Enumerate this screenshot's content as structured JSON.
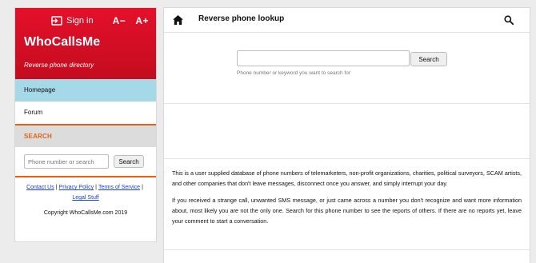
{
  "sidebar": {
    "signin_label": "Sign in",
    "font_decrease": "A−",
    "font_increase": "A+",
    "site_name": "WhoCallsMe",
    "tagline": "Reverse phone directory",
    "nav": {
      "home": "Homepage",
      "forum": "Forum"
    },
    "search_heading": "Search",
    "search_placeholder": "Phone number or search",
    "search_button": "Search",
    "footer": {
      "contact": "Contact Us",
      "privacy": "Privacy Policy",
      "terms": "Terms of Service",
      "legal": "Legal Stuff",
      "separator": "|",
      "copyright": "Copyright WhoCallsMe.com 2019"
    }
  },
  "main": {
    "title": "Reverse phone lookup",
    "search_value": "",
    "search_button": "Search",
    "search_hint": "Phone number or keyword you want to search for",
    "paragraphs": [
      "This is a user supplied database of phone numbers of telemarketers, non-profit organizations, charities, political surveyors, SCAM artists, and other companies that don't leave messages, disconnect once you answer, and simply interrupt your day.",
      "If you received a strange call, unwanted SMS message, or just came across a number you don't recognize and want more information about, most likely you are not the only one. Search for this phone number to see the reports of others. If there are no reports yet, leave your comment to start a conversation."
    ]
  },
  "icons": {
    "signin": "signin-icon",
    "home": "home-icon",
    "search": "search-icon"
  },
  "colors": {
    "brand_red": "#d50e24",
    "accent_orange": "#e06313",
    "nav_active": "#a5d9e8",
    "link_blue": "#1a3ed8"
  }
}
